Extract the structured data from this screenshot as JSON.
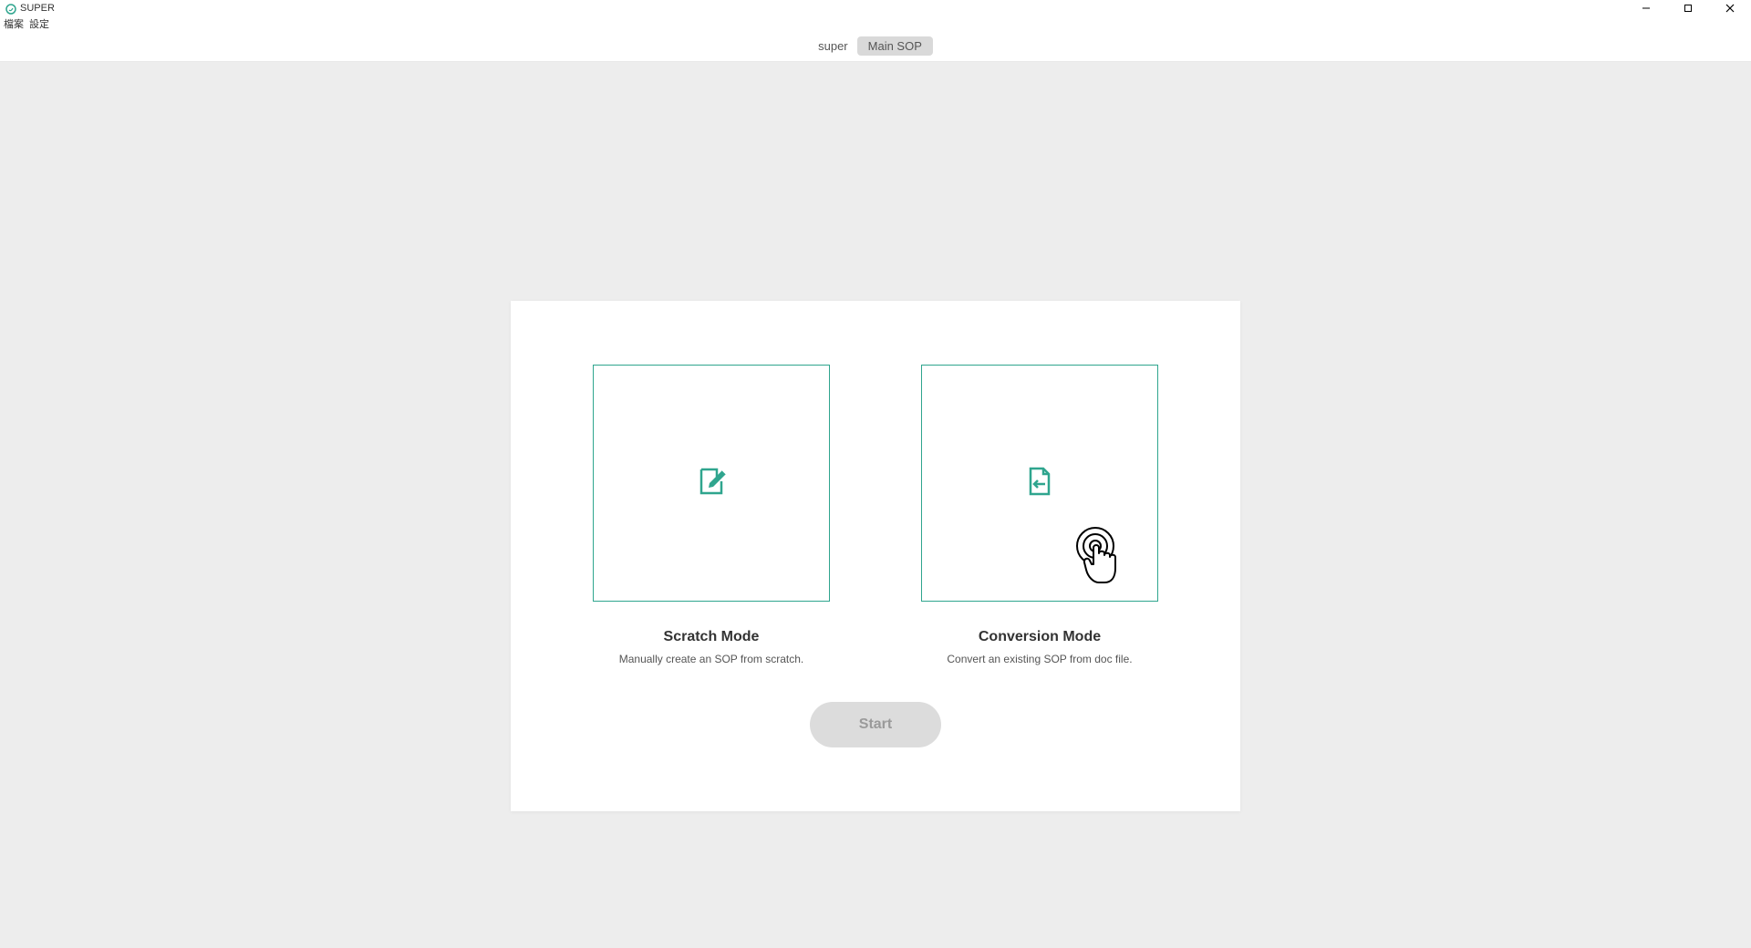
{
  "window": {
    "title": "SUPER"
  },
  "menu": {
    "file": "檔案",
    "settings": "設定"
  },
  "tabs": {
    "primary": "super",
    "secondary": "Main SOP"
  },
  "options": {
    "scratch": {
      "title": "Scratch Mode",
      "desc": "Manually create an SOP from scratch."
    },
    "conversion": {
      "title": "Conversion Mode",
      "desc": "Convert an existing SOP from doc file."
    }
  },
  "start_button": "Start",
  "colors": {
    "accent": "#2fa58e"
  }
}
